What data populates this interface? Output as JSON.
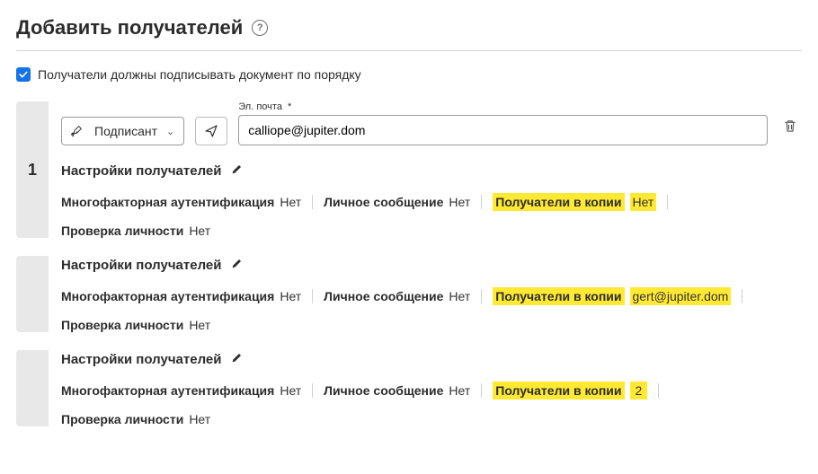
{
  "header": {
    "title": "Добавить получателей"
  },
  "order": {
    "label": "Получатели должны подписывать документ по порядку",
    "checked": true
  },
  "labels": {
    "email": "Эл. почта",
    "settings": "Настройки получателей",
    "mfa": "Многофакторная аутентификация",
    "personal_msg": "Личное сообщение",
    "cc": "Получатели в копии",
    "identity": "Проверка личности",
    "no": "Нет"
  },
  "recipients": [
    {
      "order": "1",
      "role": "Подписант",
      "email": "calliope@jupiter.dom",
      "mfa": "Нет",
      "personal_msg": "Нет",
      "cc": "Нет",
      "identity": "Нет",
      "show_identity_row": false
    },
    {
      "order": "",
      "role": "",
      "email": "",
      "mfa": "Нет",
      "personal_msg": "Нет",
      "cc": "gert@jupiter.dom",
      "identity": "Нет",
      "show_identity_row": true
    },
    {
      "order": "",
      "role": "",
      "email": "",
      "mfa": "Нет",
      "personal_msg": "Нет",
      "cc": "2",
      "identity": "Нет",
      "show_identity_row": false
    }
  ]
}
